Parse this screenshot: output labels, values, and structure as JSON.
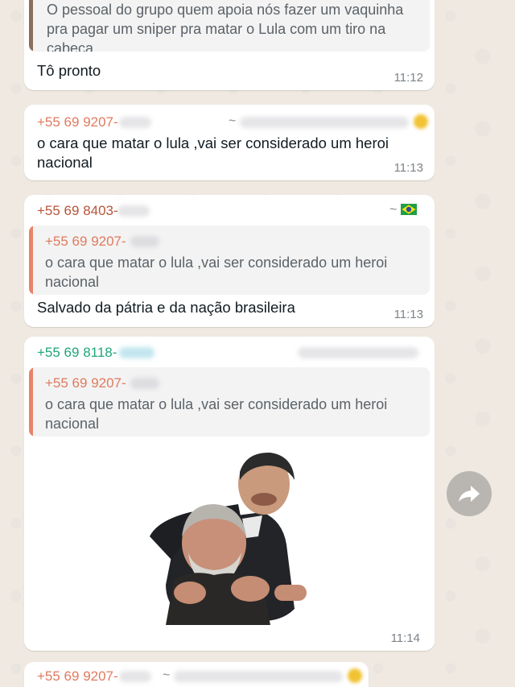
{
  "messages": [
    {
      "quote_text": "O pessoal do grupo  quem apoia nós fazer um vaquinha pra pagar um sniper pra matar o Lula com um tiro na cabeça",
      "text": "Tô pronto",
      "time": "11:12"
    },
    {
      "sender": "+55 69 9207-",
      "pushname_prefix": "~",
      "text": "o cara que matar o lula ,vai ser considerado um heroi nacional",
      "time": "11:13"
    },
    {
      "sender": "+55 69 8403-",
      "pushname_prefix": "~",
      "quote_sender": "+55 69 9207-",
      "quote_text": "o cara que matar o lula ,vai ser considerado um heroi nacional",
      "text": "Salvado da pátria  e da nação brasileira",
      "time": "11:13"
    },
    {
      "sender": "+55 69 8118-",
      "quote_sender": "+55 69 9207-",
      "quote_text": "o cara que matar o lula ,vai ser considerado um heroi nacional",
      "time": "11:14"
    },
    {
      "sender": "+55 69 9207-",
      "pushname_prefix": "~"
    }
  ],
  "colors": {
    "sender_orange": "#e07a5f",
    "sender_brown": "#b8543a",
    "sender_green": "#1fa67a",
    "quote_bar_brown": "#8b6f5e",
    "quote_bar_orange": "#e8836a"
  },
  "icons": [
    "brazil-flag-icon",
    "forward-icon",
    "sticker-image"
  ]
}
